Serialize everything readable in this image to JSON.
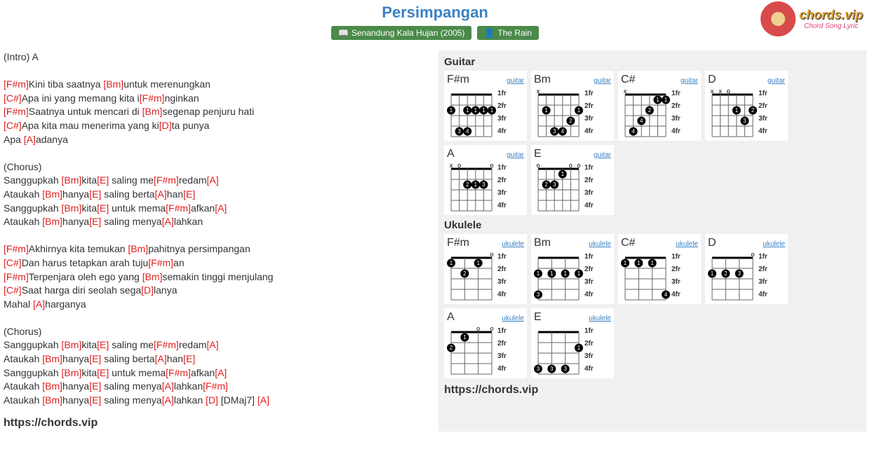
{
  "title": "Persimpangan",
  "album": "Senandung Kala Hujan (2005)",
  "artist": "The Rain",
  "logo_main": "chords.vip",
  "logo_sub": "Chord Song Lyric",
  "footer_url": "https://chords.vip",
  "lyrics": [
    {
      "type": "plain",
      "text": "(Intro) A"
    },
    {
      "type": "blank"
    },
    {
      "type": "line",
      "parts": [
        {
          "c": "[F#m]"
        },
        {
          "t": "Kini tiba saatnya "
        },
        {
          "c": "[Bm]"
        },
        {
          "t": "untuk merenungkan"
        }
      ]
    },
    {
      "type": "line",
      "parts": [
        {
          "c": "[C#]"
        },
        {
          "t": "Apa ini yang memang kita i"
        },
        {
          "c": "[F#m]"
        },
        {
          "t": "nginkan"
        }
      ]
    },
    {
      "type": "line",
      "parts": [
        {
          "c": "[F#m]"
        },
        {
          "t": "Saatnya untuk mencari di "
        },
        {
          "c": "[Bm]"
        },
        {
          "t": "segenap penjuru hati"
        }
      ]
    },
    {
      "type": "line",
      "parts": [
        {
          "c": "[C#]"
        },
        {
          "t": "Apa kita mau menerima yang ki"
        },
        {
          "c": "[D]"
        },
        {
          "t": "ta punya"
        }
      ]
    },
    {
      "type": "line",
      "parts": [
        {
          "t": "Apa "
        },
        {
          "c": "[A]"
        },
        {
          "t": "adanya"
        }
      ]
    },
    {
      "type": "blank"
    },
    {
      "type": "plain",
      "text": "(Chorus)"
    },
    {
      "type": "line",
      "parts": [
        {
          "t": "Sanggupkah "
        },
        {
          "c": "[Bm]"
        },
        {
          "t": "kita"
        },
        {
          "c": "[E]"
        },
        {
          "t": " saling me"
        },
        {
          "c": "[F#m]"
        },
        {
          "t": "redam"
        },
        {
          "c": "[A]"
        }
      ]
    },
    {
      "type": "line",
      "parts": [
        {
          "t": "Ataukah "
        },
        {
          "c": "[Bm]"
        },
        {
          "t": "hanya"
        },
        {
          "c": "[E]"
        },
        {
          "t": " saling berta"
        },
        {
          "c": "[A]"
        },
        {
          "t": "han"
        },
        {
          "c": "[E]"
        }
      ]
    },
    {
      "type": "line",
      "parts": [
        {
          "t": "Sanggupkah "
        },
        {
          "c": "[Bm]"
        },
        {
          "t": "kita"
        },
        {
          "c": "[E]"
        },
        {
          "t": " untuk mema"
        },
        {
          "c": "[F#m]"
        },
        {
          "t": "afkan"
        },
        {
          "c": "[A]"
        }
      ]
    },
    {
      "type": "line",
      "parts": [
        {
          "t": "Ataukah "
        },
        {
          "c": "[Bm]"
        },
        {
          "t": "hanya"
        },
        {
          "c": "[E]"
        },
        {
          "t": " saling menya"
        },
        {
          "c": "[A]"
        },
        {
          "t": "lahkan"
        }
      ]
    },
    {
      "type": "blank"
    },
    {
      "type": "line",
      "parts": [
        {
          "c": "[F#m]"
        },
        {
          "t": "Akhirnya kita temukan "
        },
        {
          "c": "[Bm]"
        },
        {
          "t": "pahitnya persimpangan"
        }
      ]
    },
    {
      "type": "line",
      "parts": [
        {
          "c": "[C#]"
        },
        {
          "t": "Dan harus tetapkan arah tuju"
        },
        {
          "c": "[F#m]"
        },
        {
          "t": "an"
        }
      ]
    },
    {
      "type": "line",
      "parts": [
        {
          "c": "[F#m]"
        },
        {
          "t": "Terpenjara oleh ego yang "
        },
        {
          "c": "[Bm]"
        },
        {
          "t": "semakin tinggi menjulang"
        }
      ]
    },
    {
      "type": "line",
      "parts": [
        {
          "c": "[C#]"
        },
        {
          "t": "Saat harga diri seolah sega"
        },
        {
          "c": "[D]"
        },
        {
          "t": "lanya"
        }
      ]
    },
    {
      "type": "line",
      "parts": [
        {
          "t": "Mahal "
        },
        {
          "c": "[A]"
        },
        {
          "t": "harganya"
        }
      ]
    },
    {
      "type": "blank"
    },
    {
      "type": "plain",
      "text": "(Chorus)"
    },
    {
      "type": "line",
      "parts": [
        {
          "t": "Sanggupkah "
        },
        {
          "c": "[Bm]"
        },
        {
          "t": "kita"
        },
        {
          "c": "[E]"
        },
        {
          "t": " saling me"
        },
        {
          "c": "[F#m]"
        },
        {
          "t": "redam"
        },
        {
          "c": "[A]"
        }
      ]
    },
    {
      "type": "line",
      "parts": [
        {
          "t": "Ataukah "
        },
        {
          "c": "[Bm]"
        },
        {
          "t": "hanya"
        },
        {
          "c": "[E]"
        },
        {
          "t": " saling berta"
        },
        {
          "c": "[A]"
        },
        {
          "t": "han"
        },
        {
          "c": "[E]"
        }
      ]
    },
    {
      "type": "line",
      "parts": [
        {
          "t": "Sanggupkah "
        },
        {
          "c": "[Bm]"
        },
        {
          "t": "kita"
        },
        {
          "c": "[E]"
        },
        {
          "t": " untuk mema"
        },
        {
          "c": "[F#m]"
        },
        {
          "t": "afkan"
        },
        {
          "c": "[A]"
        }
      ]
    },
    {
      "type": "line",
      "parts": [
        {
          "t": "Ataukah "
        },
        {
          "c": "[Bm]"
        },
        {
          "t": "hanya"
        },
        {
          "c": "[E]"
        },
        {
          "t": " saling menya"
        },
        {
          "c": "[A]"
        },
        {
          "t": "lahkan"
        },
        {
          "c": "[F#m]"
        }
      ]
    },
    {
      "type": "line",
      "parts": [
        {
          "t": "Ataukah "
        },
        {
          "c": "[Bm]"
        },
        {
          "t": "hanya"
        },
        {
          "c": "[E]"
        },
        {
          "t": " saling menya"
        },
        {
          "c": "[A]"
        },
        {
          "t": "lahkan "
        },
        {
          "c": "[D]"
        },
        {
          "t": " [DMaj7] "
        },
        {
          "c": "[A]"
        }
      ]
    }
  ],
  "sections": [
    {
      "title": "Guitar",
      "inst": "guitar",
      "strings": 6,
      "chords": [
        {
          "name": "F#m",
          "open": [
            "",
            "",
            "",
            "",
            "",
            ""
          ],
          "dots": [
            {
              "s": 0,
              "f": 2,
              "n": "1"
            },
            {
              "s": 2,
              "f": 2,
              "n": "1"
            },
            {
              "s": 3,
              "f": 2,
              "n": "1"
            },
            {
              "s": 4,
              "f": 2,
              "n": "1"
            },
            {
              "s": 5,
              "f": 2,
              "n": "1"
            },
            {
              "s": 1,
              "f": 4,
              "n": "3"
            },
            {
              "s": 2,
              "f": 4,
              "n": "4"
            }
          ]
        },
        {
          "name": "Bm",
          "open": [
            "x",
            "",
            "",
            "",
            "",
            ""
          ],
          "dots": [
            {
              "s": 1,
              "f": 2,
              "n": "1"
            },
            {
              "s": 5,
              "f": 2,
              "n": "1"
            },
            {
              "s": 4,
              "f": 3,
              "n": "2"
            },
            {
              "s": 2,
              "f": 4,
              "n": "3"
            },
            {
              "s": 3,
              "f": 4,
              "n": "4"
            }
          ]
        },
        {
          "name": "C#",
          "open": [
            "x",
            "",
            "",
            "",
            "",
            ""
          ],
          "dots": [
            {
              "s": 4,
              "f": 1,
              "n": "1"
            },
            {
              "s": 5,
              "f": 1,
              "n": "1"
            },
            {
              "s": 3,
              "f": 2,
              "n": "2"
            },
            {
              "s": 2,
              "f": 3,
              "n": "4"
            },
            {
              "s": 1,
              "f": 4,
              "n": "4"
            }
          ]
        },
        {
          "name": "D",
          "open": [
            "x",
            "x",
            "o",
            "",
            "",
            ""
          ],
          "dots": [
            {
              "s": 3,
              "f": 2,
              "n": "1"
            },
            {
              "s": 5,
              "f": 2,
              "n": "2"
            },
            {
              "s": 4,
              "f": 3,
              "n": "3"
            }
          ]
        },
        {
          "name": "A",
          "open": [
            "x",
            "o",
            "",
            "",
            "",
            "o"
          ],
          "dots": [
            {
              "s": 2,
              "f": 2,
              "n": "2"
            },
            {
              "s": 3,
              "f": 2,
              "n": "1"
            },
            {
              "s": 4,
              "f": 2,
              "n": "3"
            }
          ]
        },
        {
          "name": "E",
          "open": [
            "o",
            "",
            "",
            "",
            "o",
            "o"
          ],
          "dots": [
            {
              "s": 3,
              "f": 1,
              "n": "1"
            },
            {
              "s": 1,
              "f": 2,
              "n": "2"
            },
            {
              "s": 2,
              "f": 2,
              "n": "3"
            }
          ]
        }
      ]
    },
    {
      "title": "Ukulele",
      "inst": "ukulele",
      "strings": 4,
      "chords": [
        {
          "name": "F#m",
          "open": [
            "",
            "",
            "",
            "o"
          ],
          "dots": [
            {
              "s": 0,
              "f": 1,
              "n": "1"
            },
            {
              "s": 2,
              "f": 1,
              "n": "1"
            },
            {
              "s": 1,
              "f": 2,
              "n": "2"
            }
          ]
        },
        {
          "name": "Bm",
          "open": [
            "",
            "",
            "",
            ""
          ],
          "dots": [
            {
              "s": 0,
              "f": 2,
              "n": "1"
            },
            {
              "s": 1,
              "f": 2,
              "n": "1"
            },
            {
              "s": 2,
              "f": 2,
              "n": "1"
            },
            {
              "s": 3,
              "f": 2,
              "n": "1"
            },
            {
              "s": 0,
              "f": 4,
              "n": "3"
            }
          ]
        },
        {
          "name": "C#",
          "open": [
            "",
            "",
            "",
            ""
          ],
          "dots": [
            {
              "s": 0,
              "f": 1,
              "n": "1"
            },
            {
              "s": 1,
              "f": 1,
              "n": "1"
            },
            {
              "s": 2,
              "f": 1,
              "n": "1"
            },
            {
              "s": 3,
              "f": 4,
              "n": "4"
            }
          ]
        },
        {
          "name": "D",
          "open": [
            "",
            "",
            "",
            "o"
          ],
          "dots": [
            {
              "s": 0,
              "f": 2,
              "n": "1"
            },
            {
              "s": 1,
              "f": 2,
              "n": "2"
            },
            {
              "s": 2,
              "f": 2,
              "n": "3"
            }
          ]
        },
        {
          "name": "A",
          "open": [
            "",
            "",
            "o",
            "o"
          ],
          "dots": [
            {
              "s": 0,
              "f": 2,
              "n": "2"
            },
            {
              "s": 1,
              "f": 1,
              "n": "1"
            }
          ]
        },
        {
          "name": "E",
          "open": [
            "",
            "",
            "",
            ""
          ],
          "dots": [
            {
              "s": 0,
              "f": 4,
              "n": "3"
            },
            {
              "s": 1,
              "f": 4,
              "n": "3"
            },
            {
              "s": 2,
              "f": 4,
              "n": "3"
            },
            {
              "s": 3,
              "f": 2,
              "n": "1"
            }
          ]
        }
      ]
    }
  ],
  "fret_labels": [
    "1fr",
    "2fr",
    "3fr",
    "4fr"
  ]
}
